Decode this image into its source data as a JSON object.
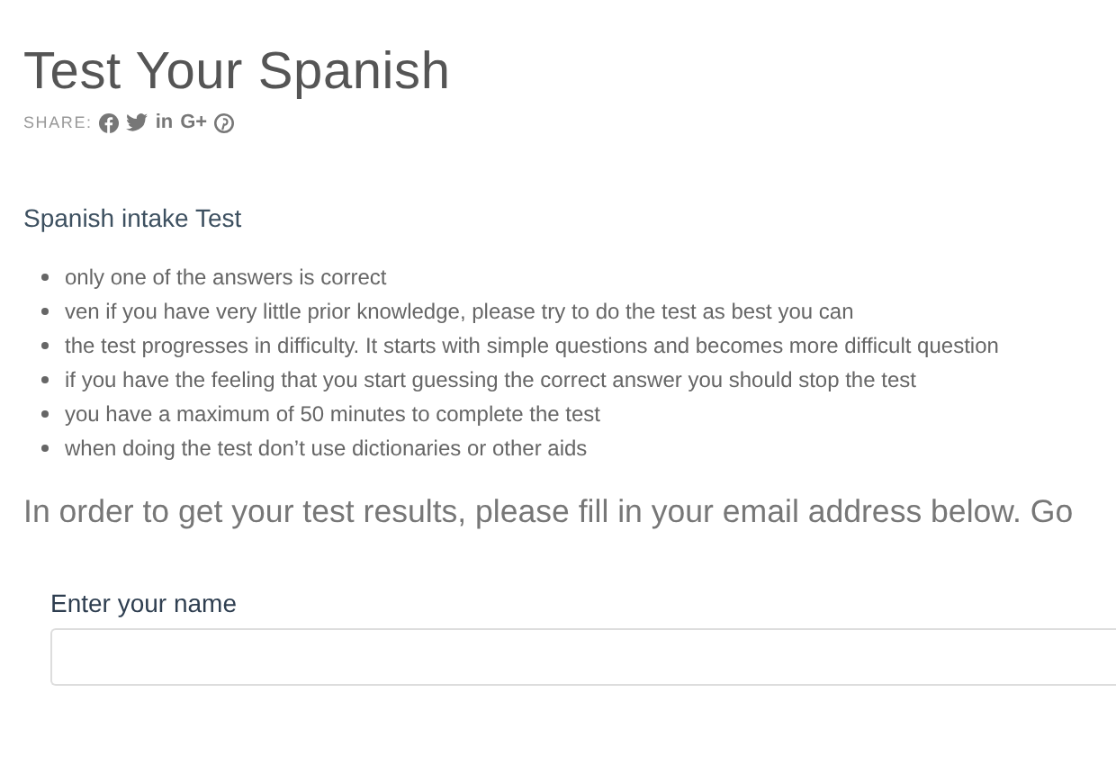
{
  "title": "Test Your Spanish",
  "share": {
    "label": "SHARE:",
    "icons": [
      {
        "kind": "facebook"
      },
      {
        "kind": "twitter"
      },
      {
        "kind": "text",
        "text": "in"
      },
      {
        "kind": "text",
        "text": "G+"
      },
      {
        "kind": "pinterest"
      }
    ]
  },
  "section_title": "Spanish intake Test",
  "rules": [
    "only one of the answers is correct",
    "ven if you have very little prior knowledge, please try to do the test as best you can",
    "the test progresses in difficulty. It starts with simple questions and becomes more difficult question",
    "if you have the feeling that you start guessing the correct answer you should stop the test",
    "you have a maximum of 50 minutes to complete the test",
    "when doing the test don’t use dictionaries or other aids"
  ],
  "intro": "In order to get your test results, please fill in your email address below. Go",
  "name_field": {
    "label": "Enter your name"
  }
}
